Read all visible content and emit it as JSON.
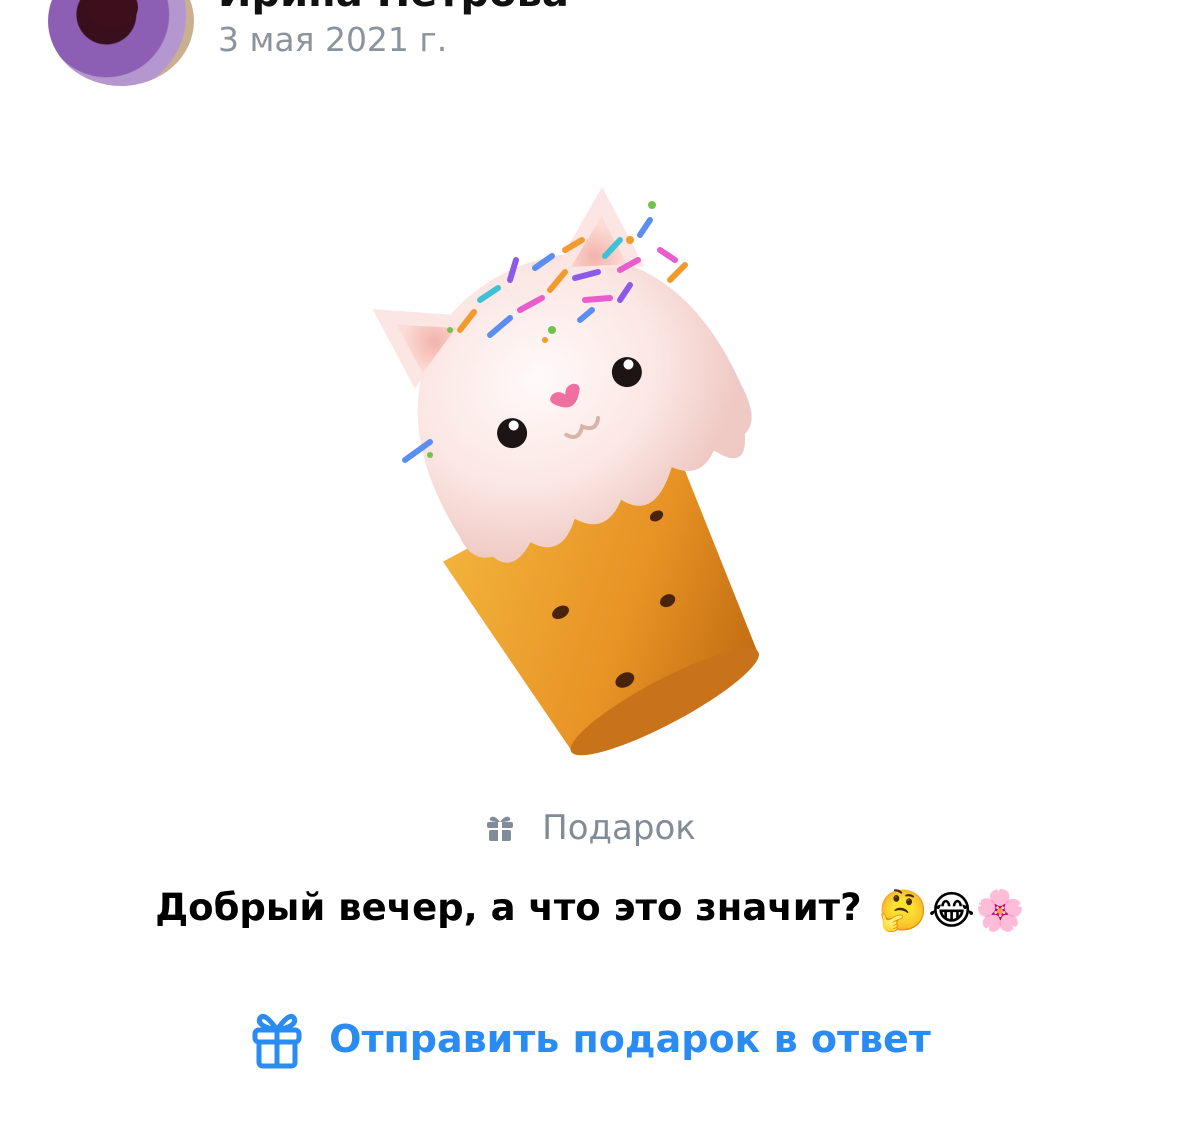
{
  "post": {
    "author": "Ирина Петрова",
    "date": "3 мая 2021 г."
  },
  "gift": {
    "type_label": "Подарок",
    "message": "Добрый вечер, а что это значит?",
    "emojis": "🤔😂🌸",
    "reply_label": "Отправить подарок в ответ"
  },
  "colors": {
    "accent": "#2a8bf2",
    "secondary_text": "#818c99"
  }
}
